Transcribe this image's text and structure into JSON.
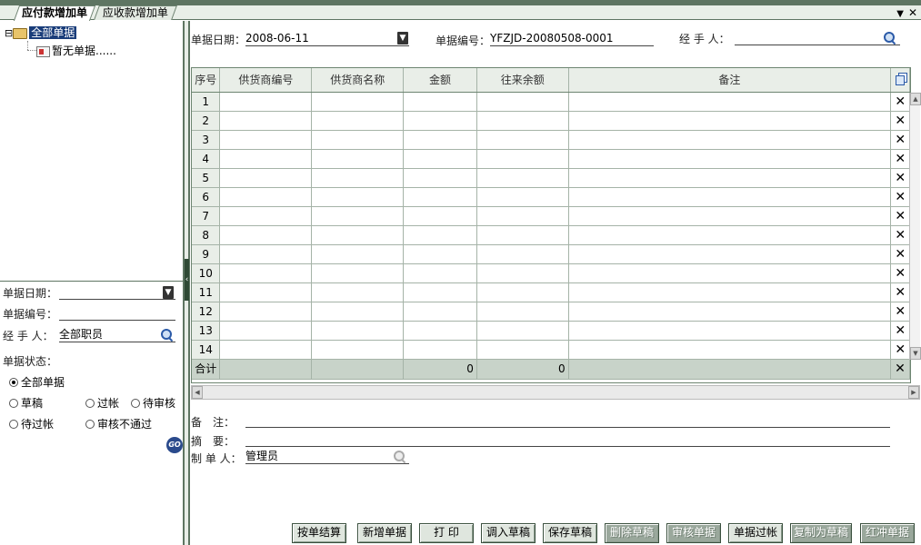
{
  "tabs": [
    {
      "label": "应付款增加单",
      "active": true
    },
    {
      "label": "应收款增加单",
      "active": false
    }
  ],
  "window_controls": {
    "menu": "▼",
    "close": "✕"
  },
  "tree": {
    "expand_glyph": "⊟",
    "root": "全部单据",
    "child": "暂无单据......"
  },
  "filter": {
    "date_label": "单据日期：",
    "date_value": "",
    "number_label": "单据编号：",
    "number_value": "",
    "handler_label": "经 手 人：",
    "handler_value": "全部职员",
    "status_label": "单据状态：",
    "statuses": [
      "全部单据",
      "草稿",
      "过帐",
      "待审核",
      "待过帐",
      "审核不通过"
    ],
    "selected_status": "全部单据",
    "go_label": "GO"
  },
  "form": {
    "date_label": "单据日期：",
    "date_value": "2008-06-11",
    "number_label": "单据编号：",
    "number_value": "YFZJD-20080508-0001",
    "handler_label": "经 手 人：",
    "handler_value": ""
  },
  "grid": {
    "columns": [
      "序号",
      "供货商编号",
      "供货商名称",
      "金额",
      "往来余额",
      "备注"
    ],
    "rows": [
      "1",
      "2",
      "3",
      "4",
      "5",
      "6",
      "7",
      "8",
      "9",
      "10",
      "11",
      "12",
      "13",
      "14"
    ],
    "total_label": "合计",
    "total_amount": "0",
    "total_balance": "0",
    "delete_glyph": "✕"
  },
  "footer": {
    "remark_label": "备　注：",
    "remark_value": "",
    "summary_label": "摘　要：",
    "summary_value": "",
    "creator_label": "制 单 人：",
    "creator_value": "管理员"
  },
  "buttons": [
    {
      "label": "按单结算",
      "enabled": true
    },
    {
      "label": "新增单据",
      "enabled": true
    },
    {
      "label": "打 印",
      "enabled": true
    },
    {
      "label": "调入草稿",
      "enabled": true
    },
    {
      "label": "保存草稿",
      "enabled": true
    },
    {
      "label": "删除草稿",
      "enabled": false
    },
    {
      "label": "审核单据",
      "enabled": false
    },
    {
      "label": "单据过帐",
      "enabled": true
    },
    {
      "label": "复制为草稿",
      "enabled": false
    },
    {
      "label": "红冲单据",
      "enabled": false
    }
  ]
}
